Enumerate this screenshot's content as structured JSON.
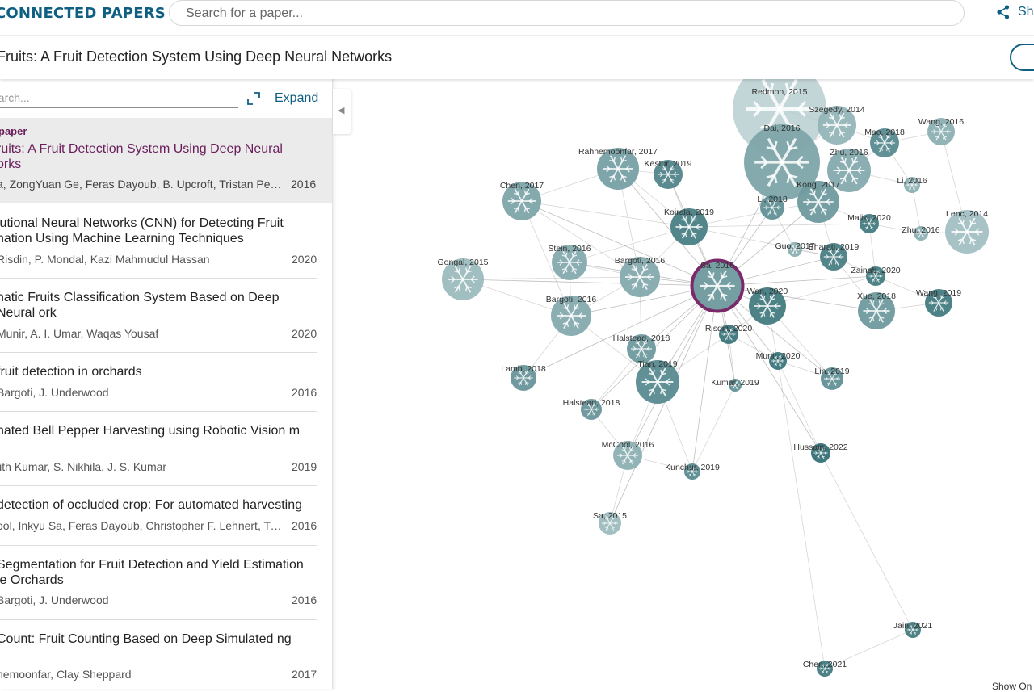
{
  "header": {
    "logo_text": "CONNECTED PAPERS",
    "search_placeholder": "Search for a paper...",
    "share_label": "Sh",
    "accent_color": "#0e5f82"
  },
  "title_bar": {
    "paper_title": "Fruits: A Fruit Detection System Using Deep Neural Networks"
  },
  "sidebar": {
    "search_placeholder": "earch...",
    "expand_label": "Expand",
    "origin": {
      "tag": "paper",
      "title": "ruits: A Fruit Detection System Using Deep Neural orks",
      "authors": "a, ZongYuan Ge, Feras Dayoub, B. Upcroft, Tristan Perez, ...",
      "year": "2016"
    },
    "items": [
      {
        "title": "lutional Neural Networks (CNN) for Detecting Fruit nation Using Machine Learning Techniques",
        "authors": "Risdin, P. Mondal, Kazi Mahmudul Hassan",
        "year": "2020"
      },
      {
        "title": "natic Fruits Classification System Based on Deep Neural ork",
        "authors": "Munir, A. I. Umar, Waqas Yousaf",
        "year": "2020"
      },
      {
        "title": "fruit detection in orchards",
        "authors": "Bargoti, J. Underwood",
        "year": "2016"
      },
      {
        "title": "nated Bell Pepper Harvesting using Robotic Vision m",
        "authors": "jith Kumar, S. Nikhila, J. S. Kumar",
        "year": "2019"
      },
      {
        "title": "detection of occluded crop: For automated harvesting",
        "authors": "ool, Inkyu Sa, Feras Dayoub, Christopher F. Lehnert, Trista...",
        "year": "2016"
      },
      {
        "title": "Segmentation for Fruit Detection and Yield Estimation le Orchards",
        "authors": "Bargoti, J. Underwood",
        "year": "2016"
      },
      {
        "title": "Count: Fruit Counting Based on Deep Simulated ng",
        "authors": "nemoonfar, Clay Sheppard",
        "year": "2017"
      }
    ]
  },
  "graph": {
    "show_only_label": "Show On",
    "selected_node": "Sa, 2016",
    "selected_color": "#7a2a6a",
    "nodes": [
      {
        "label": "Redmon, 2015"
      },
      {
        "label": "Szegedy, 2014"
      },
      {
        "label": "Mao, 2018"
      },
      {
        "label": "Wang, 2016"
      },
      {
        "label": "Dai, 2016"
      },
      {
        "label": "Zhu, 2016"
      },
      {
        "label": "Li, 2016"
      },
      {
        "label": "Rahnemoonfar, 2017"
      },
      {
        "label": "Kestur, 2019"
      },
      {
        "label": "Chen, 2017"
      },
      {
        "label": "Li, 2018"
      },
      {
        "label": "Kong, 2017"
      },
      {
        "label": "Koirala, 2019"
      },
      {
        "label": "Malik, 2020"
      },
      {
        "label": "Zhu, 2016"
      },
      {
        "label": "Lenc, 2014"
      },
      {
        "label": "Guo, 2017"
      },
      {
        "label": "Bharati, 2019"
      },
      {
        "label": "Stein, 2016"
      },
      {
        "label": "Gongal, 2015"
      },
      {
        "label": "Bargoti, 2016"
      },
      {
        "label": "Sa, 2016"
      },
      {
        "label": "Zainab, 2020"
      },
      {
        "label": "Wan, 2020"
      },
      {
        "label": "Xue, 2018"
      },
      {
        "label": "Wang, 2019"
      },
      {
        "label": "Bargoti, 2016"
      },
      {
        "label": "Risdin, 2020"
      },
      {
        "label": "Halstead, 2018"
      },
      {
        "label": "Munir, 2020"
      },
      {
        "label": "Lamb, 2018"
      },
      {
        "label": "Tian, 2019"
      },
      {
        "label": "Kumar, 2019"
      },
      {
        "label": "Lin, 2019"
      },
      {
        "label": "Halstead, 2018"
      },
      {
        "label": "McCool, 2016"
      },
      {
        "label": "Hussain, 2022"
      },
      {
        "label": "Kunchur, 2019"
      },
      {
        "label": "Sa, 2015"
      },
      {
        "label": "Jain, 2021"
      },
      {
        "label": "Chen, 2021"
      }
    ]
  }
}
